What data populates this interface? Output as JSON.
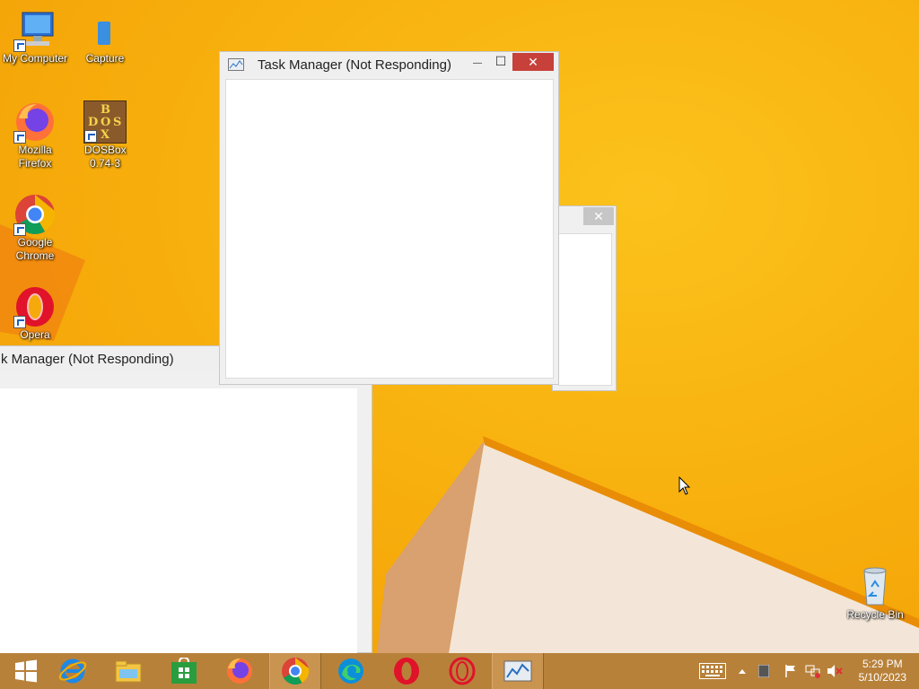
{
  "desktop": {
    "icons": [
      {
        "label": "My Computer"
      },
      {
        "label": "Capture"
      },
      {
        "label": "Mozilla Firefox"
      },
      {
        "label": "DOSBox 0.74-3",
        "logo_letters": [
          "B",
          "D",
          "O",
          "S",
          "X"
        ]
      },
      {
        "label": "Google Chrome"
      },
      {
        "label": "Opera"
      },
      {
        "label": "Recycle Bin"
      }
    ]
  },
  "windows": {
    "front": {
      "title": "Task Manager (Not Responding)",
      "minimize_glyph": "—",
      "maximize_glyph": "☐",
      "close_glyph": "✕"
    },
    "back_left": {
      "title": "k Manager (Not Responding)"
    },
    "back_right": {
      "close_glyph": "✕"
    }
  },
  "taskbar": {
    "items": [
      "start-icon",
      "internet-explorer-icon",
      "file-explorer-icon",
      "store-icon",
      "firefox-icon",
      "chrome-icon",
      "edge-icon",
      "opera-icon",
      "opera-gx-icon",
      "task-manager-icon"
    ],
    "tray": [
      "keyboard-icon",
      "show-hidden-icons",
      "tray-app-icon",
      "action-center-flag-icon",
      "network-icon",
      "volume-muted-icon"
    ],
    "clock": {
      "time": "5:29 PM",
      "date": "5/10/2023"
    }
  },
  "colors": {
    "accent_close": "#c7403a",
    "taskbar": "#b8813a",
    "desktop": "#f6a90a"
  }
}
